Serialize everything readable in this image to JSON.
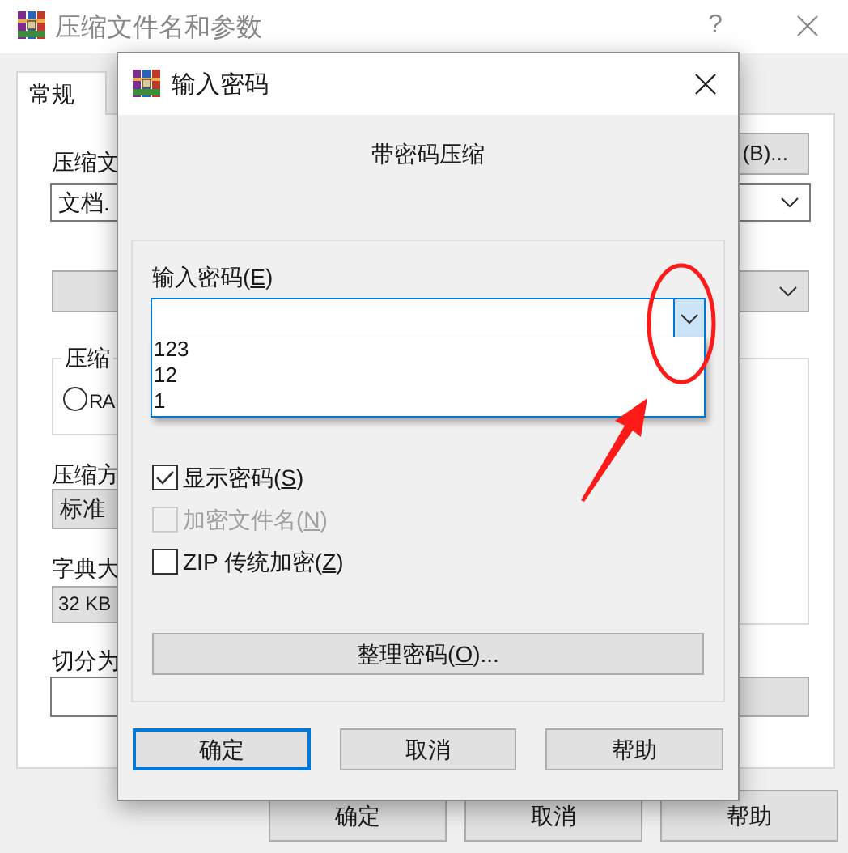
{
  "window": {
    "title": "压缩文件名和参数",
    "help": "?"
  },
  "tabs": [
    {
      "label": "常规",
      "selected": true
    }
  ],
  "background": {
    "archive_label": "压缩文",
    "archive_value": "文档.",
    "browse_button": "(B)...",
    "format_group": "压缩",
    "format_option": {
      "label": "RA",
      "selected": false
    },
    "method_label": "压缩方",
    "method_value": "标准",
    "dict_label": "字典大",
    "dict_value": "32 KB",
    "split_label": "切分为"
  },
  "buttons": [
    "确定",
    "取消",
    "帮助"
  ],
  "dialog": {
    "title": "输入密码",
    "heading": "带密码压缩",
    "password": {
      "prefix": "输入密码(",
      "key": "E",
      "suffix": ")",
      "expanded": true,
      "history": [
        "123",
        "12",
        "1"
      ]
    },
    "options": [
      {
        "prefix": "显示密码(",
        "key": "S",
        "suffix": ")",
        "checked": true,
        "disabled": false
      },
      {
        "prefix": "加密文件名(",
        "key": "N",
        "suffix": ")",
        "checked": false,
        "disabled": true
      },
      {
        "prefix": "ZIP 传统加密(",
        "key": "Z",
        "suffix": ")",
        "checked": false,
        "disabled": false
      }
    ],
    "organize": {
      "prefix": "整理密码(",
      "key": "O",
      "suffix": ")..."
    },
    "buttons": [
      {
        "label": "确定",
        "default": true
      },
      {
        "label": "取消",
        "default": false
      },
      {
        "label": "帮助",
        "default": false
      }
    ]
  }
}
